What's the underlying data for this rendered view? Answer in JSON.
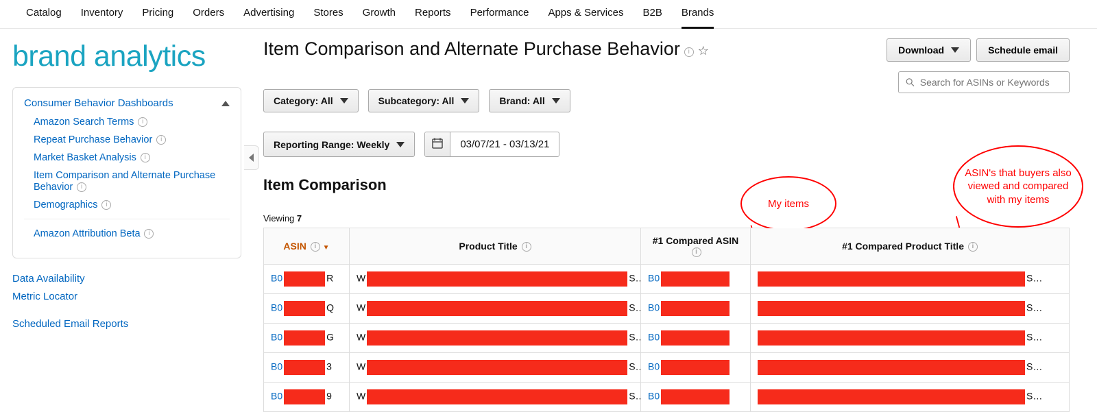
{
  "nav": {
    "items": [
      "Catalog",
      "Inventory",
      "Pricing",
      "Orders",
      "Advertising",
      "Stores",
      "Growth",
      "Reports",
      "Performance",
      "Apps & Services",
      "B2B",
      "Brands"
    ],
    "active": "Brands"
  },
  "logo": "brand analytics",
  "sidebar": {
    "group_title": "Consumer Behavior Dashboards",
    "items": [
      {
        "label": "Amazon Search Terms"
      },
      {
        "label": "Repeat Purchase Behavior"
      },
      {
        "label": "Market Basket Analysis"
      },
      {
        "label": "Item Comparison and Alternate Purchase Behavior"
      },
      {
        "label": "Demographics"
      }
    ],
    "extra": {
      "label": "Amazon Attribution Beta"
    },
    "utility": [
      {
        "label": "Data Availability"
      },
      {
        "label": "Metric Locator"
      },
      {
        "label": "Scheduled Email Reports"
      }
    ]
  },
  "header": {
    "title": "Item Comparison and Alternate Purchase Behavior",
    "download": "Download",
    "schedule": "Schedule email"
  },
  "search": {
    "placeholder": "Search for ASINs or Keywords"
  },
  "filters": {
    "category": "Category: All",
    "subcategory": "Subcategory: All",
    "brand": "Brand: All",
    "reporting": "Reporting Range: Weekly",
    "date_range": "03/07/21 - 03/13/21"
  },
  "section_title": "Item Comparison",
  "viewing_label": "Viewing",
  "viewing_count": "7",
  "table": {
    "cols": [
      "ASIN",
      "Product Title",
      "#1 Compared ASIN",
      "#1 Compared Product Title"
    ],
    "rows": [
      {
        "asin_l": "B0",
        "asin_r": "R",
        "pt_l": "W",
        "pt_r": "S…",
        "casin_l": "B0",
        "cpt_r": "S…"
      },
      {
        "asin_l": "B0",
        "asin_r": "Q",
        "pt_l": "W",
        "pt_r": "S…",
        "casin_l": "B0",
        "cpt_r": "S…"
      },
      {
        "asin_l": "B0",
        "asin_r": "G",
        "pt_l": "W",
        "pt_r": "S…",
        "casin_l": "B0",
        "cpt_r": "S…"
      },
      {
        "asin_l": "B0",
        "asin_r": "3",
        "pt_l": "W",
        "pt_r": "S…",
        "casin_l": "B0",
        "cpt_r": "S…"
      },
      {
        "asin_l": "B0",
        "asin_r": "9",
        "pt_l": "W",
        "pt_r": "S…",
        "casin_l": "B0",
        "cpt_r": "S…"
      }
    ]
  },
  "annotations": {
    "bubble1": "My items",
    "bubble2": "ASIN's that buyers also viewed and compared with my items"
  }
}
